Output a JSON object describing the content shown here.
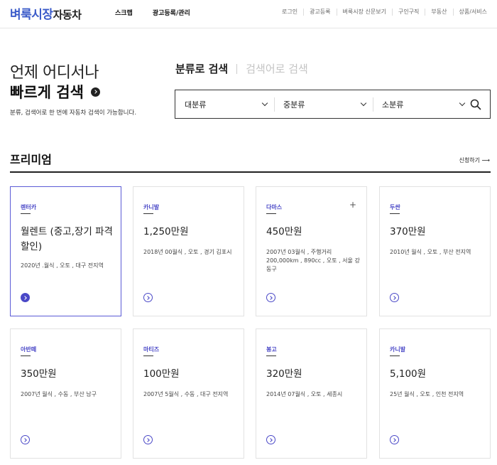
{
  "header": {
    "logo_brand": "벼룩시장",
    "logo_sub": "자동차",
    "nav": [
      "스크랩",
      "광고등록/관리"
    ],
    "util": [
      "로그인",
      "광고등록",
      "벼룩시장 신문보기",
      "구인구직",
      "부동산",
      "상품/서비스"
    ]
  },
  "hero": {
    "title": "언제 어디서나",
    "subtitle": "빠르게 검색",
    "description": "분류, 검색어로 한 번에 자동차 검색이 가능합니다."
  },
  "search": {
    "tab_active": "분류로 검색",
    "tab_inactive": "검색어로 검색",
    "selects": [
      "대분류",
      "중분류",
      "소분류"
    ],
    "search_icon": "search-icon"
  },
  "premium": {
    "title": "프리미엄",
    "more": "신청하기 ⟶",
    "cards": [
      {
        "category": "렌터카",
        "price": "월렌트 (중고,장기 파격할인)",
        "desc": "2020년 .월식 , 오토 , 대구 전지역"
      },
      {
        "category": "카니발",
        "price": "1,250만원",
        "desc": "2018년 00월식 , 오토 , 경기 김포시"
      },
      {
        "category": "다마스",
        "price": "450만원",
        "desc": "2007년 03월식 , 주행거리 200,000km , 890cc , 오토 , 서울 강동구"
      },
      {
        "category": "두싼",
        "price": "370만원",
        "desc": "2010년 월식 , 오토 , 부산 전지역"
      },
      {
        "category": "아반떼",
        "price": "350만원",
        "desc": "2007년 월식 , 수동 , 부산 남구"
      },
      {
        "category": "마티즈",
        "price": "100만원",
        "desc": "2007년 5월식 , 수동 , 대구 전지역"
      },
      {
        "category": "봉고",
        "price": "320만원",
        "desc": "2014년 07월식 , 오토 , 세종시"
      },
      {
        "category": "카니발",
        "price": "5,100원",
        "desc": "25년 월식 , 오토 , 인천 전지역"
      }
    ]
  },
  "colors": {
    "brand": "#3b5bc9",
    "accent": "#4a48c7"
  }
}
